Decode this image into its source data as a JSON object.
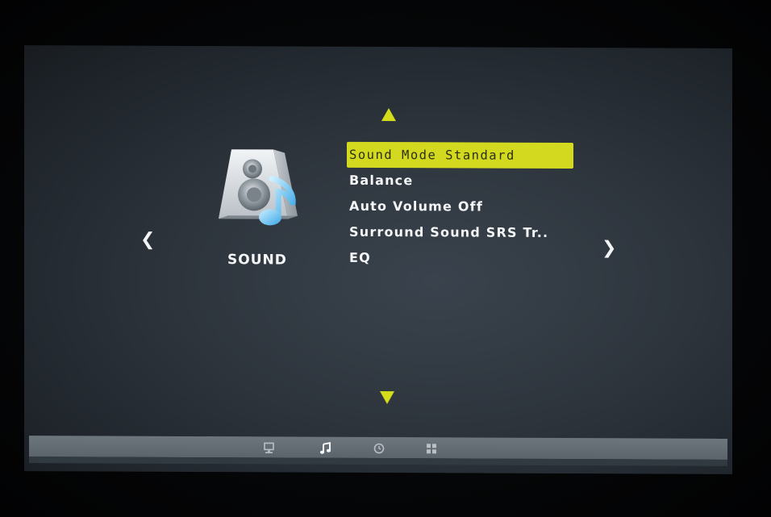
{
  "menu": {
    "category": {
      "label": "SOUND",
      "icon": "speaker-music-icon"
    },
    "items": [
      {
        "label": "Sound Mode Standard",
        "selected": true
      },
      {
        "label": "Balance",
        "selected": false
      },
      {
        "label": "Auto Volume Off",
        "selected": false
      },
      {
        "label": "Surround Sound SRS Tr..",
        "selected": false
      },
      {
        "label": "EQ",
        "selected": false
      }
    ]
  },
  "navigation": {
    "prev_icon": "chevron-left-icon",
    "next_icon": "chevron-right-icon",
    "up_icon": "triangle-up-icon",
    "down_icon": "triangle-down-icon"
  },
  "bottom_tabs": [
    {
      "icon": "monitor-icon",
      "active": false
    },
    {
      "icon": "music-note-icon",
      "active": true
    },
    {
      "icon": "clock-icon",
      "active": false
    },
    {
      "icon": "grid-icon",
      "active": false
    }
  ],
  "colors": {
    "highlight": "#d3d91f",
    "arrow": "#d4dc1c",
    "text": "#f4f6f8",
    "screen_bg": "#2d343c"
  }
}
